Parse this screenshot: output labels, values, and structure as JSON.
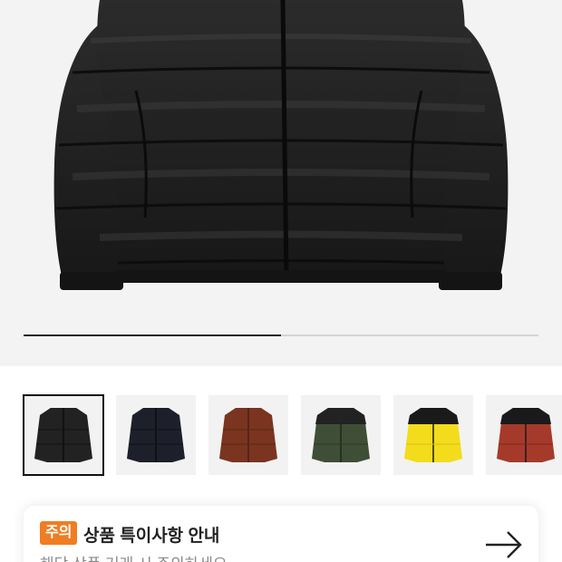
{
  "product_images": {
    "main_image": "jacket-black-front",
    "slider_progress": 0.5,
    "thumbnails": [
      {
        "color_name": "black",
        "body": "#222222",
        "shoulder": "#222222",
        "selected": true
      },
      {
        "color_name": "navy",
        "body": "#1d1f2a",
        "shoulder": "#1d1f2a",
        "selected": false
      },
      {
        "color_name": "brown",
        "body": "#7a3420",
        "shoulder": "#7a3420",
        "selected": false
      },
      {
        "color_name": "green",
        "body": "#3f4e36",
        "shoulder": "#222222",
        "selected": false
      },
      {
        "color_name": "yellow",
        "body": "#f2dc1c",
        "shoulder": "#1a1a1a",
        "selected": false
      },
      {
        "color_name": "red",
        "body": "#a63a2a",
        "shoulder": "#1a1a1a",
        "selected": false
      }
    ]
  },
  "notice": {
    "badge": "주의",
    "title": "상품 특이사항 안내",
    "subtitle": "해당 상품 거래 시 주의하세요",
    "arrow_icon": "arrow-right-icon"
  }
}
